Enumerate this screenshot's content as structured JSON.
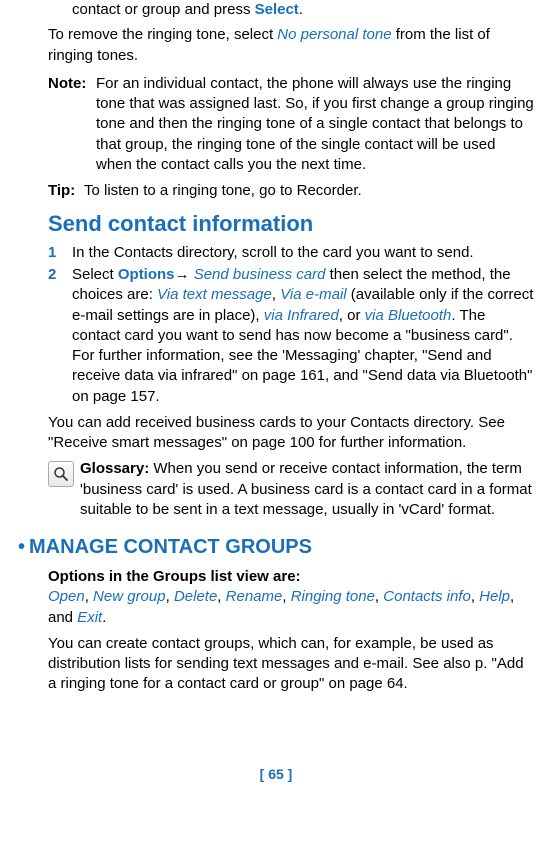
{
  "top": {
    "line1_prefix": "contact or group and press ",
    "select": "Select",
    "line1_suffix": ".",
    "remove_prefix": "To remove the ringing tone, select ",
    "no_personal": "No personal tone",
    "remove_suffix": " from the list of ringing tones."
  },
  "note": {
    "label": "Note:",
    "body": "For an individual contact, the phone will always use the ringing tone that was assigned last. So, if you first change a group ringing tone and then the ringing tone of a single contact that belongs to that group, the ringing tone of the single contact will be used when the contact calls you the next time."
  },
  "tip": {
    "label": "Tip:",
    "body": "To listen to a ringing tone, go to Recorder."
  },
  "sendHeader": "Send contact information",
  "step1": {
    "num": "1",
    "body": "In the Contacts directory, scroll to the card you want to send."
  },
  "step2": {
    "num": "2",
    "t1": "Select ",
    "options": "Options",
    "arrow": "→ ",
    "sbc": "Send business card",
    "t2": " then select the method, the choices are: ",
    "via_text": "Via text message",
    "c1": ", ",
    "via_email": "Via e-mail",
    "t3": " (available only if the correct e-mail settings are in place), ",
    "via_ir": "via Infrared",
    "t4": ", or ",
    "via_bt": "via Bluetooth",
    "t5": ". The contact card you want to send has now become a \"business card\". For further information, see the 'Messaging' chapter, \"Send and receive data via infrared\" on page 161, and \"Send data via Bluetooth\" on page 157."
  },
  "afterSteps": "You can add received business cards to your Contacts directory. See \"Receive smart messages\" on page 100 for further information.",
  "glossary": {
    "label": "Glossary:",
    "body": " When you send or receive contact information, the term 'business card' is used. A business card is a contact card in a format suitable to be sent in a text message, usually in 'vCard' format."
  },
  "manage": {
    "bullet": "•",
    "title": "MANAGE CONTACT GROUPS",
    "optsLabel": "Options in the Groups list view are:",
    "open": "Open",
    "newgroup": "New group",
    "delete": "Delete",
    "rename": "Rename",
    "ringing": "Ringing tone",
    "cinfo": "Contacts info",
    "help": "Help",
    "and": ", and ",
    "exit": "Exit",
    "c": ", ",
    "period": ".",
    "body": "You can create contact groups, which can, for example, be used as distribution lists for sending text messages and e-mail. See also p. \"Add a ringing tone for a contact card or group\" on page 64."
  },
  "pageNum": "[ 65 ]"
}
